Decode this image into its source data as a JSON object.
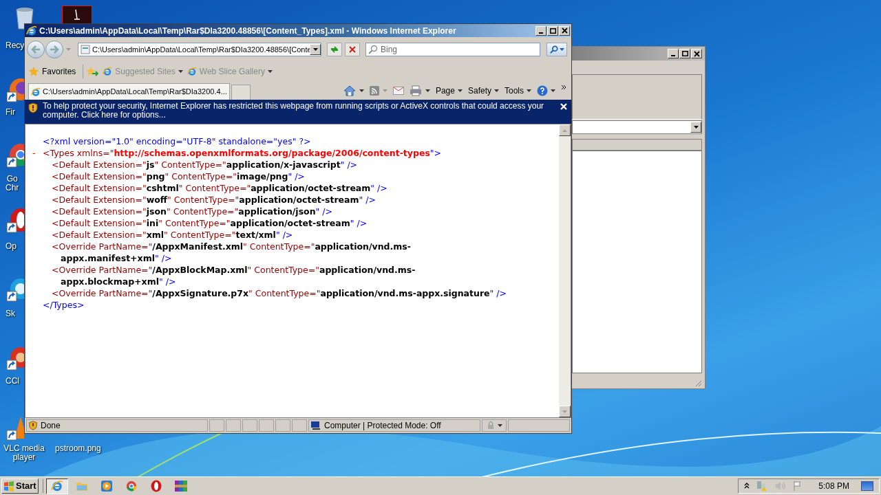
{
  "desktop_icons": [
    {
      "kind": "recycle",
      "label": [
        "Recy"
      ]
    },
    {
      "kind": "document"
    },
    {
      "kind": "firefox",
      "label": [
        "Fir"
      ]
    },
    {
      "kind": "chrome",
      "label": [
        "Go",
        "Chr"
      ]
    },
    {
      "kind": "opera",
      "label": [
        "Op"
      ]
    },
    {
      "kind": "skype",
      "label": [
        "Sk"
      ]
    },
    {
      "kind": "ccleaner",
      "label": [
        "CCl"
      ]
    },
    {
      "kind": "vlc",
      "label": [
        "VLC media",
        "player"
      ]
    },
    {
      "kind": "image",
      "label": [
        "pstroom.png"
      ]
    }
  ],
  "browser": {
    "title": "C:\\Users\\admin\\AppData\\Local\\Temp\\Rar$DIa3200.48856\\[Content_Types].xml - Windows Internet Explorer",
    "address": "C:\\Users\\admin\\AppData\\Local\\Temp\\Rar$DIa3200.48856\\[Conte",
    "search": {
      "placeholder": "Bing"
    },
    "favorites": [
      {
        "label": "Favorites",
        "disabled": false
      },
      {
        "label": "Suggested Sites",
        "disabled": true
      },
      {
        "label": "Web Slice Gallery",
        "disabled": true
      }
    ],
    "tab": {
      "label": "C:\\Users\\admin\\AppData\\Local\\Temp\\Rar$DIa3200.4...",
      "selected": true
    },
    "commands": [
      "Page",
      "Safety",
      "Tools"
    ],
    "info_bar": "To help protect your security, Internet Explorer has restricted this webpage from running scripts or ActiveX controls that could access your computer. Click here for options...",
    "xml": {
      "declaration": "<?xml version=\"1.0\" encoding=\"UTF-8\" standalone=\"yes\" ?>",
      "root": {
        "toggle": "-",
        "open": [
          {
            "kind": "tag",
            "text": "<Types"
          },
          {
            "kind": "attr",
            "text": " xmlns=\""
          },
          {
            "kind": "ns",
            "text": "http://schemas.openxmlformats.org/package/2006/content-types"
          },
          {
            "kind": "end",
            "text": "\">"
          }
        ],
        "children": [
          {
            "rows": [
              [
                {
                  "kind": "tag",
                  "text": "<Default"
                },
                {
                  "kind": "attr",
                  "text": " Extension=\""
                },
                {
                  "kind": "value",
                  "text": "js"
                },
                {
                  "kind": "attr",
                  "text": "\" ContentType=\""
                },
                {
                  "kind": "value",
                  "text": "application/x-javascript"
                },
                {
                  "kind": "end",
                  "text": "\" />"
                }
              ]
            ]
          },
          {
            "rows": [
              [
                {
                  "kind": "tag",
                  "text": "<Default"
                },
                {
                  "kind": "attr",
                  "text": " Extension=\""
                },
                {
                  "kind": "value",
                  "text": "png"
                },
                {
                  "kind": "attr",
                  "text": "\" ContentType=\""
                },
                {
                  "kind": "value",
                  "text": "image/png"
                },
                {
                  "kind": "end",
                  "text": "\" />"
                }
              ]
            ]
          },
          {
            "rows": [
              [
                {
                  "kind": "tag",
                  "text": "<Default"
                },
                {
                  "kind": "attr",
                  "text": " Extension=\""
                },
                {
                  "kind": "value",
                  "text": "cshtml"
                },
                {
                  "kind": "attr",
                  "text": "\" ContentType=\""
                },
                {
                  "kind": "value",
                  "text": "application/octet-stream"
                },
                {
                  "kind": "end",
                  "text": "\" />"
                }
              ]
            ]
          },
          {
            "rows": [
              [
                {
                  "kind": "tag",
                  "text": "<Default"
                },
                {
                  "kind": "attr",
                  "text": " Extension=\""
                },
                {
                  "kind": "value",
                  "text": "woff"
                },
                {
                  "kind": "attr",
                  "text": "\" ContentType=\""
                },
                {
                  "kind": "value",
                  "text": "application/octet-stream"
                },
                {
                  "kind": "end",
                  "text": "\" />"
                }
              ]
            ]
          },
          {
            "rows": [
              [
                {
                  "kind": "tag",
                  "text": "<Default"
                },
                {
                  "kind": "attr",
                  "text": " Extension=\""
                },
                {
                  "kind": "value",
                  "text": "json"
                },
                {
                  "kind": "attr",
                  "text": "\" ContentType=\""
                },
                {
                  "kind": "value",
                  "text": "application/json"
                },
                {
                  "kind": "end",
                  "text": "\" />"
                }
              ]
            ]
          },
          {
            "rows": [
              [
                {
                  "kind": "tag",
                  "text": "<Default"
                },
                {
                  "kind": "attr",
                  "text": " Extension=\""
                },
                {
                  "kind": "value",
                  "text": "ini"
                },
                {
                  "kind": "attr",
                  "text": "\" ContentType=\""
                },
                {
                  "kind": "value",
                  "text": "application/octet-stream"
                },
                {
                  "kind": "end",
                  "text": "\" />"
                }
              ]
            ]
          },
          {
            "rows": [
              [
                {
                  "kind": "tag",
                  "text": "<Default"
                },
                {
                  "kind": "attr",
                  "text": " Extension=\""
                },
                {
                  "kind": "value",
                  "text": "xml"
                },
                {
                  "kind": "attr",
                  "text": "\" ContentType=\""
                },
                {
                  "kind": "value",
                  "text": "text/xml"
                },
                {
                  "kind": "end",
                  "text": "\" />"
                }
              ]
            ]
          },
          {
            "rows": [
              [
                {
                  "kind": "tag",
                  "text": "<Override"
                },
                {
                  "kind": "attr",
                  "text": " PartName=\""
                },
                {
                  "kind": "value",
                  "text": "/AppxManifest.xml"
                },
                {
                  "kind": "attr",
                  "text": "\" ContentType=\""
                },
                {
                  "kind": "value",
                  "text": "application/vnd.ms-"
                }
              ]
            ],
            "continued": [
              {
                "kind": "value",
                "text": "appx.manifest+xml"
              },
              {
                "kind": "end",
                "text": "\" />"
              }
            ]
          },
          {
            "rows": [
              [
                {
                  "kind": "tag",
                  "text": "<Override"
                },
                {
                  "kind": "attr",
                  "text": " PartName=\""
                },
                {
                  "kind": "value",
                  "text": "/AppxBlockMap.xml"
                },
                {
                  "kind": "attr",
                  "text": "\" ContentType=\""
                },
                {
                  "kind": "value",
                  "text": "application/vnd.ms-"
                }
              ]
            ],
            "continued": [
              {
                "kind": "value",
                "text": "appx.blockmap+xml"
              },
              {
                "kind": "end",
                "text": "\" />"
              }
            ]
          },
          {
            "rows": [
              [
                {
                  "kind": "tag",
                  "text": "<Override"
                },
                {
                  "kind": "attr",
                  "text": " PartName=\""
                },
                {
                  "kind": "value",
                  "text": "/AppxSignature.p7x"
                },
                {
                  "kind": "attr",
                  "text": "\" ContentType=\""
                },
                {
                  "kind": "value",
                  "text": "application/vnd.ms-appx.signature"
                },
                {
                  "kind": "end",
                  "text": "\" />"
                }
              ]
            ]
          }
        ],
        "close": "</Types>"
      }
    },
    "status": {
      "text": "Done",
      "zone": "Computer | Protected Mode: Off"
    }
  },
  "taskbar": {
    "start": "Start",
    "items": [
      {
        "kind": "ie",
        "selected": true
      },
      {
        "kind": "folder",
        "selected": false
      },
      {
        "kind": "media",
        "selected": false
      },
      {
        "kind": "chrome",
        "selected": false
      },
      {
        "kind": "opera",
        "selected": false
      },
      {
        "kind": "archive",
        "selected": false
      }
    ],
    "clock": "5:08 PM"
  }
}
